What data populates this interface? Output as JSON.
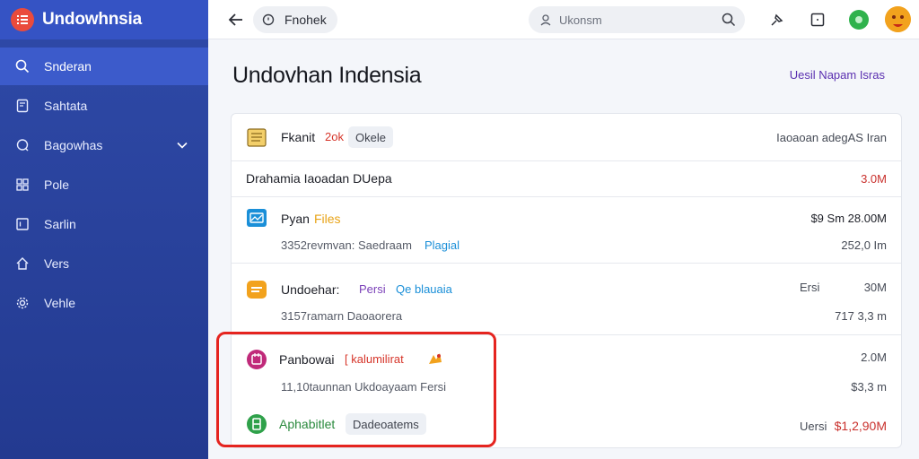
{
  "app": {
    "title": "Undowhnsia"
  },
  "sidebar": {
    "items": [
      {
        "label": "Snderan",
        "icon": "search-icon"
      },
      {
        "label": "Sahtata",
        "icon": "document-icon"
      },
      {
        "label": "Bagowhas",
        "icon": "chat-icon"
      },
      {
        "label": "Pole",
        "icon": "grid-icon"
      },
      {
        "label": "Sarlin",
        "icon": "calendar-icon"
      },
      {
        "label": "Vers",
        "icon": "home-icon"
      },
      {
        "label": "Vehle",
        "icon": "gear-icon"
      }
    ]
  },
  "topbar": {
    "tab_label": "Fnohek",
    "search_placeholder": "Ukonsm"
  },
  "main": {
    "title": "Undovhan Indensia",
    "header_link": "Uesil Napam Isras"
  },
  "rows": {
    "r1": {
      "title": "Fkanit",
      "tag": "2ok",
      "badge": "Okele",
      "right": "Iaoaoan adegAS Iran"
    },
    "r2": {
      "title": "Drahamia Iaoadan DUepa",
      "right": "3.0M"
    },
    "r3": {
      "title": "Pyan",
      "tag": "Files",
      "right": "$9 Sm 28.00M",
      "sub_main": "3352revmvan: Saedraam",
      "sub_link": "Plagial",
      "right2": "252,0 Im"
    },
    "r4": {
      "title": "Undoehar:",
      "tag": "Persi",
      "tag2": "Qe blauaia",
      "right_label": "Ersi",
      "right": "30M",
      "sub": "3157ramarn Daoaorera",
      "right2": "717 3,3 m"
    },
    "r5": {
      "title": "Panbowai",
      "tag": "[ kalumilirat",
      "right": "2.0M",
      "sub": "11,10taunnan Ukdoayaam Fersi",
      "right2": "$3,3 m"
    },
    "r6": {
      "title": "Aphabitlet",
      "badge": "Dadeoatems",
      "right_label": "Uersi",
      "right": "$1,2,90M"
    }
  },
  "colors": {
    "sidebar": "#2a43a0",
    "accent_red": "#e5241f",
    "link_purple": "#5a2fb0",
    "tag_blue": "#1a8fd8",
    "tag_orange": "#e8a317",
    "green": "#2fa14a"
  }
}
